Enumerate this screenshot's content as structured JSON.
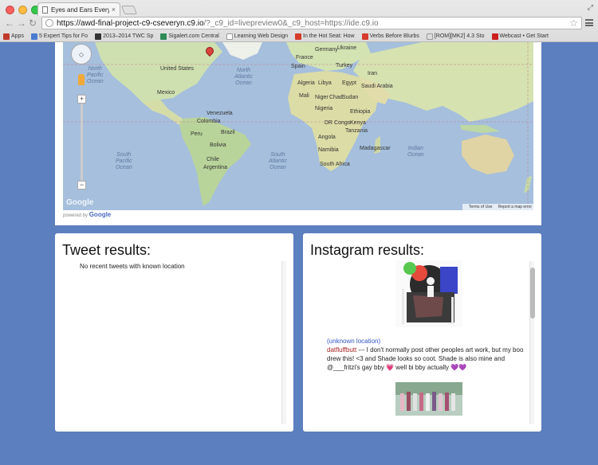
{
  "browser": {
    "tab_title": "Eyes and Ears Everywhere",
    "tab_close": "×",
    "url_host": "https://awd-final-project-c9-cseveryn.c9.io",
    "url_rest": "/?_c9_id=livepreview0&_c9_host=https://ide.c9.io",
    "bookmarks": [
      {
        "label": "Apps",
        "color": "#c0392b"
      },
      {
        "label": "5 Expert Tips for Fo",
        "color": "#4a7bd0"
      },
      {
        "label": "2013–2014 TWC Sp",
        "color": "#333333"
      },
      {
        "label": "Sigalert.com Central",
        "color": "#2e8b57"
      },
      {
        "label": "Learning Web Design",
        "color": "#ffffff"
      },
      {
        "label": "In the Hot Seat: How",
        "color": "#d63a2c"
      },
      {
        "label": "Verbs Before Blurbs",
        "color": "#d63a2c"
      },
      {
        "label": "[ROM][MK2] 4.3 Sto",
        "color": "#dddddd"
      },
      {
        "label": "Webcast • Get Start",
        "color": "#cc1f1f"
      }
    ]
  },
  "map": {
    "labels": {
      "north_pacific": "North\nPacific\nOcean",
      "north_atlantic": "North\nAtlantic\nOcean",
      "south_pacific": "South\nPacific\nOcean",
      "south_atlantic": "South\nAtlantic\nOcean",
      "indian": "Indian\nOcean",
      "united_states": "United States",
      "mexico": "Mexico",
      "brazil": "Brazil",
      "peru": "Peru",
      "chile": "Chile",
      "argentina": "Argentina",
      "colombia": "Colombia",
      "venezuela": "Venezuela",
      "bolivia": "Bolivia",
      "algeria": "Algeria",
      "libya": "Libya",
      "egypt": "Egypt",
      "mali": "Mali",
      "niger": "Niger",
      "chad": "Chad",
      "sudan": "Sudan",
      "nigeria": "Nigeria",
      "ethiopia": "Ethiopia",
      "dr_congo": "DR Congo",
      "kenya": "Kenya",
      "tanzania": "Tanzania",
      "angola": "Angola",
      "namibia": "Namibia",
      "south_africa": "South Africa",
      "madagascar": "Madagascar",
      "france": "France",
      "spain": "Spain",
      "turkey": "Turkey",
      "iran": "Iran",
      "saudi_arabia": "Saudi Arabia",
      "germany": "Germany",
      "ukraine": "Ukraine"
    },
    "google_logo": "Google",
    "terms": "Terms of Use",
    "report": "Report a map error",
    "powered_prefix": "powered by",
    "powered_brand": "Google"
  },
  "tweets": {
    "heading": "Tweet results:",
    "empty_message": "No recent tweets with known location"
  },
  "instagram": {
    "heading": "Instagram results:",
    "location": "(unknown location)",
    "username": "datfluffbutt",
    "caption": " --- I don't normally post other peoples art work, but my boo drew this! <3 and Shade looks so coot. Shade is also mine and @___fritzi's gay bby 💗     well bi bby actually 💜💜"
  }
}
